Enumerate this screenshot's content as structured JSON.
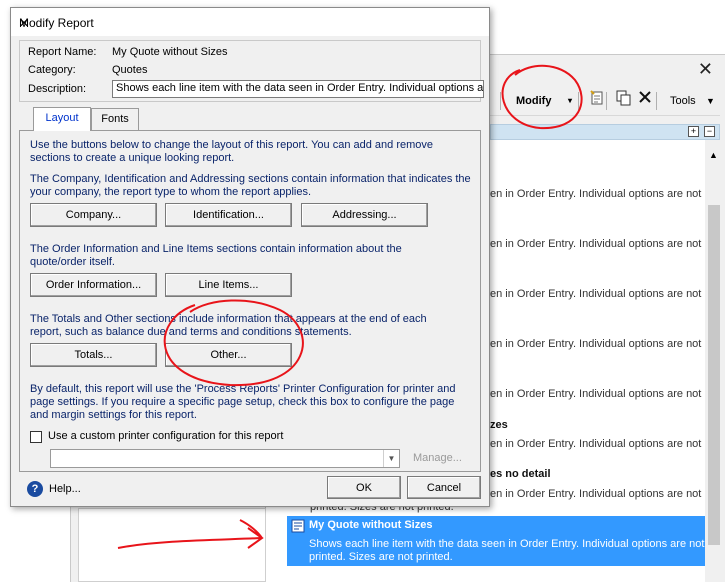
{
  "background_window": {
    "toolbar": {
      "partial_label": "s",
      "modify_label": "Modify",
      "modify_arrow": "▾",
      "tools_label": "Tools",
      "tools_arrow": "▼"
    },
    "rows": [
      {
        "text": "en in Order Entry. Individual options are not"
      },
      {
        "text": "en in Order Entry. Individual options are not"
      },
      {
        "text": "en in Order Entry. Individual options are not"
      },
      {
        "text": "en in Order Entry. Individual options are not"
      },
      {
        "text": "en in Order Entry. Individual options are not"
      },
      {
        "text": "en in Order Entry. Individual options are not"
      }
    ],
    "partial_titles": [
      "zes",
      "es no detail"
    ],
    "row7_text": "en in Order Entry. Individual options are not",
    "row8_text": "en in Order Entry. Individual options are not",
    "row8_sub": "printed. Sizes are not printed.",
    "selected": {
      "title": "My Quote without Sizes",
      "line1": "Shows each line item with the data seen in Order Entry. Individual options are not",
      "line2": "printed. Sizes are not printed."
    }
  },
  "dialog": {
    "title": "Modify Report",
    "report_name_label": "Report Name:",
    "report_name_value": "My Quote without Sizes",
    "category_label": "Category:",
    "category_value": "Quotes",
    "description_label": "Description:",
    "description_value": "Shows each line item with the data seen in Order Entry. Individual options are not printed.",
    "tabs": [
      {
        "label": "Layout"
      },
      {
        "label": "Fonts"
      }
    ],
    "layout": {
      "intro": "Use the buttons below to change the layout of this report. You can add and remove sections to create a unique looking report.",
      "header_text": "The Company, Identification and Addressing sections contain information that indicates the your company, the report type to whom the report applies.",
      "company_btn": "Company...",
      "identification_btn": "Identification...",
      "addressing_btn": "Addressing...",
      "order_text": "The Order Information and Line Items sections contain information about the quote/order itself.",
      "order_info_btn": "Order Information...",
      "line_items_btn": "Line Items...",
      "totals_text": "The Totals and Other sections include information that appears at the end of each report, such as balance due and terms and conditions statements.",
      "totals_btn": "Totals...",
      "other_btn": "Other...",
      "printer_text": "By default, this report will use the 'Process Reports' Printer Configuration for printer and page settings. If you require a specific page setup, check this box to configure the page and margin settings for this report.",
      "custom_printer_label": "Use a custom printer configuration for this report",
      "custom_printer_checked": false,
      "printer_combo_value": "",
      "manage_btn": "Manage..."
    },
    "help_label": "Help...",
    "ok_label": "OK",
    "cancel_label": "Cancel"
  },
  "colors": {
    "annotation_red": "#e8141a",
    "selection_blue": "#3399ff",
    "panel_text_blue": "#0a246a"
  }
}
